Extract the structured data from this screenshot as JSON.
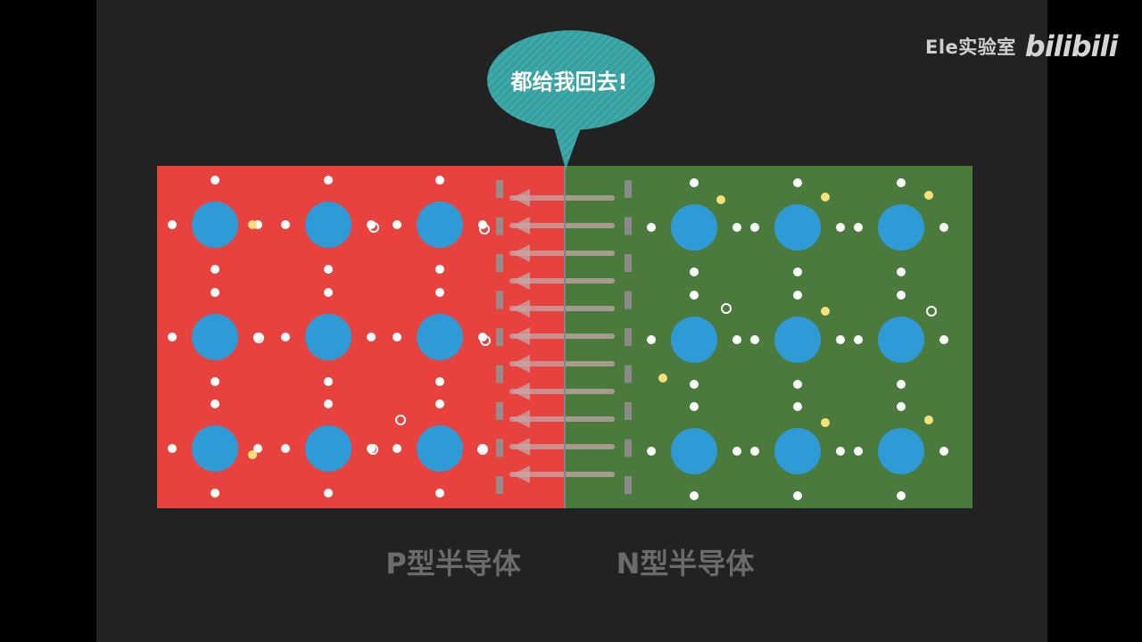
{
  "watermark": {
    "channel": "Ele实验室",
    "logo": "bilibili"
  },
  "speech_bubble": {
    "text": "都给我回去!"
  },
  "labels": {
    "p_type": "P型半导体",
    "n_type": "N型半导体"
  },
  "colors": {
    "background": "#222222",
    "p_region": "#e8423f",
    "n_region": "#4a7a3c",
    "atom": "#2e9bd6",
    "electron": "#ffffff",
    "free_electron": "#f5e07a",
    "hole": "#ffffff",
    "arrow": "#c4a7a7",
    "bubble": "#3aa2a2",
    "label": "#6b6b6b"
  },
  "icons": {
    "arrow": "left-arrow-icon",
    "bubble": "speech-bubble-icon"
  }
}
